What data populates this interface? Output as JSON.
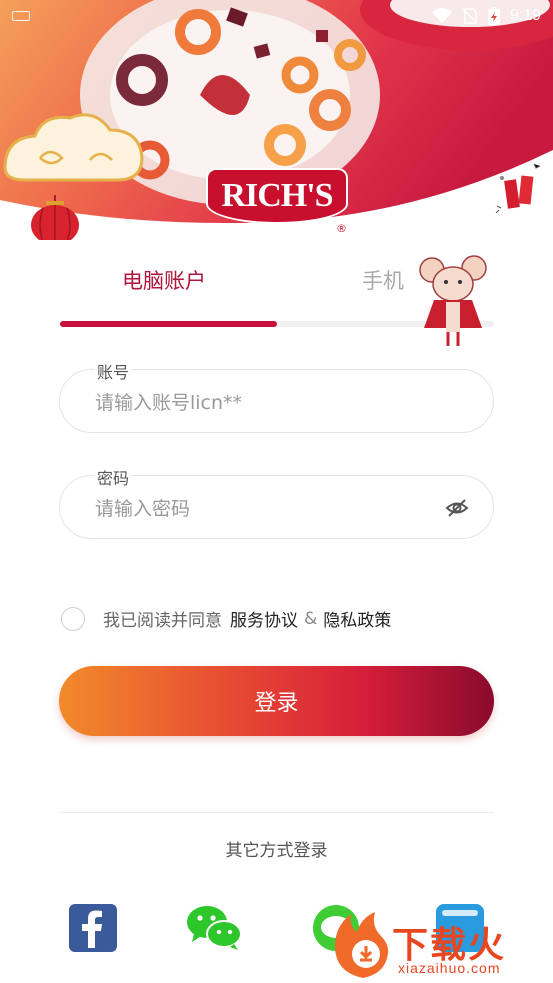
{
  "status_bar": {
    "time": "9:19"
  },
  "brand": {
    "logo_text": "RICH'S",
    "registered_mark": "®"
  },
  "tabs": [
    {
      "label": "电脑账户",
      "active": true
    },
    {
      "label": "手机",
      "active": false
    }
  ],
  "account": {
    "label": "账号",
    "placeholder": "请输入账号licn**"
  },
  "password": {
    "label": "密码",
    "placeholder": "请输入密码"
  },
  "agreement": {
    "prefix": "我已阅读并同意",
    "service_link": "服务协议",
    "amp": "&",
    "privacy_link": "隐私政策"
  },
  "login_button": "登录",
  "other_login": {
    "label": "其它方式登录",
    "icons": [
      "facebook-icon",
      "wechat-icon",
      "line-icon",
      "other-app-icon"
    ]
  },
  "watermark": {
    "text": "下载火",
    "sub": "xiazaihuo.com"
  },
  "colors": {
    "accent": "#c8103c",
    "tab_inactive": "#aaaaaa",
    "button_start": "#f28a2a",
    "button_end": "#8a0a2c"
  }
}
